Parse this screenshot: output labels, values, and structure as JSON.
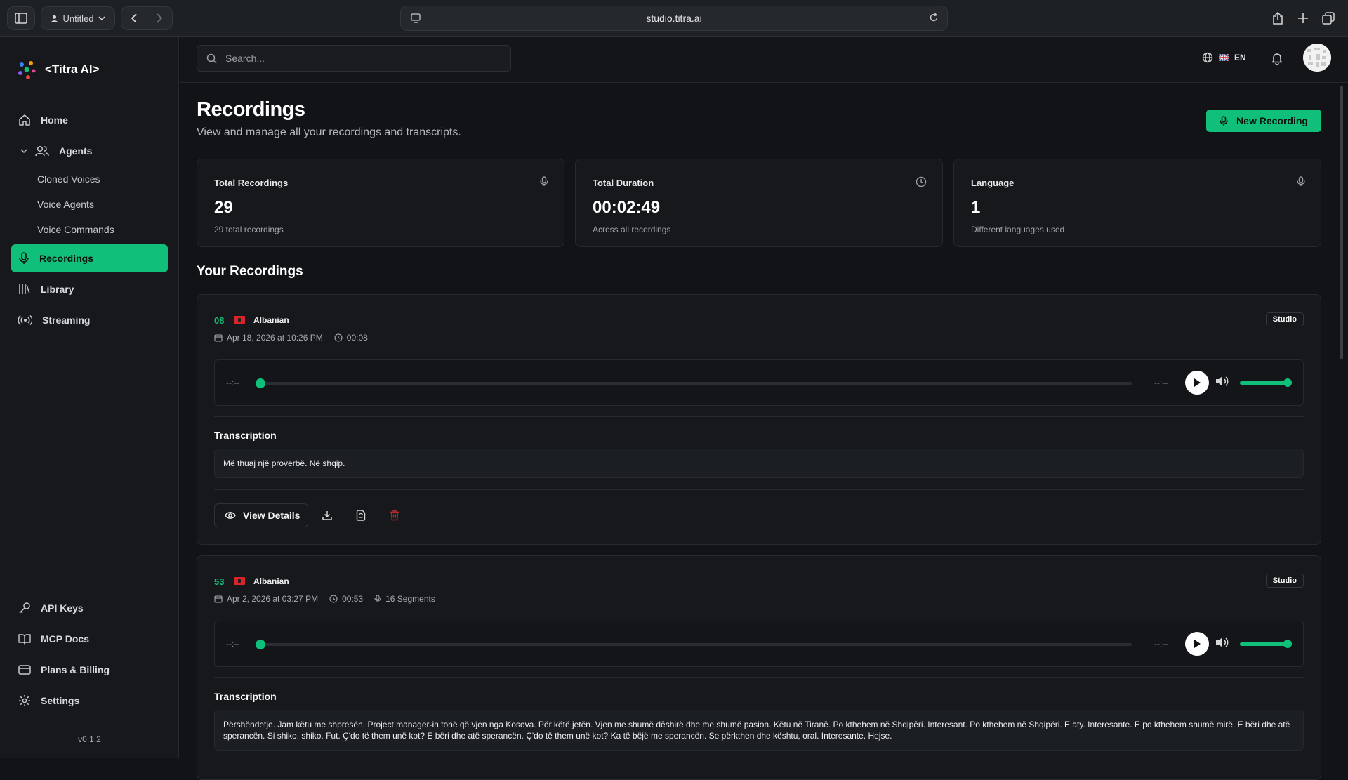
{
  "browser": {
    "tab_label": "Untitled",
    "url": "studio.titra.ai"
  },
  "sidebar": {
    "logo_text": "<Titra AI>",
    "items": [
      {
        "label": "Home",
        "icon": "home-icon"
      },
      {
        "label": "Agents",
        "icon": "users-icon"
      },
      {
        "label": "Recordings",
        "icon": "mic-icon"
      },
      {
        "label": "Library",
        "icon": "library-icon"
      },
      {
        "label": "Streaming",
        "icon": "broadcast-icon"
      }
    ],
    "agents_sub": [
      "Cloned Voices",
      "Voice Agents",
      "Voice Commands"
    ],
    "bottom_items": [
      {
        "label": "API Keys",
        "icon": "key-icon"
      },
      {
        "label": "MCP Docs",
        "icon": "book-icon"
      },
      {
        "label": "Plans & Billing",
        "icon": "card-icon"
      },
      {
        "label": "Settings",
        "icon": "gear-icon"
      }
    ],
    "version": "v0.1.2"
  },
  "topbar": {
    "search_placeholder": "Search...",
    "language": "EN"
  },
  "header": {
    "title": "Recordings",
    "subtitle": "View and manage all your recordings and transcripts.",
    "new_button": "New Recording"
  },
  "stats": [
    {
      "label": "Total Recordings",
      "value": "29",
      "sub": "29 total recordings",
      "icon": "mic-icon"
    },
    {
      "label": "Total Duration",
      "value": "00:02:49",
      "sub": "Across all recordings",
      "icon": "clock-icon"
    },
    {
      "label": "Language",
      "value": "1",
      "sub": "Different languages used",
      "icon": "mic-icon"
    }
  ],
  "section_title": "Your Recordings",
  "recordings": [
    {
      "id": "08",
      "language": "Albanian",
      "date": "Apr 18, 2026 at 10:26 PM",
      "duration": "00:08",
      "segments": "",
      "badge": "Studio",
      "time_current": "--:--",
      "time_total": "--:--",
      "transcription_label": "Transcription",
      "transcription": "Më thuaj një proverbë. Në shqip.",
      "view_details": "View Details"
    },
    {
      "id": "53",
      "language": "Albanian",
      "date": "Apr 2, 2026 at 03:27 PM",
      "duration": "00:53",
      "segments": "16 Segments",
      "badge": "Studio",
      "time_current": "--:--",
      "time_total": "--:--",
      "transcription_label": "Transcription",
      "transcription": "Përshëndetje. Jam këtu me shpresën. Project manager-in tonë që vjen nga Kosova. Për këtë jetën. Vjen me shumë dëshirë dhe me shumë pasion. Këtu në Tiranë. Po kthehem në Shqipëri. Interesant. Po kthehem në Shqipëri. E aty. Interesante. E po kthehem shumë mirë. E bëri dhe atë sperancën. Si shiko, shiko. Fut. Ç'do të them unë kot? E bëri dhe atë sperancën. Ç'do të them unë kot? Ka të bëjë me sperancën. Se përkthen dhe kështu, oral. Interesante. Hejse."
    }
  ],
  "colors": {
    "accent": "#10c07a",
    "danger": "#d13438"
  }
}
